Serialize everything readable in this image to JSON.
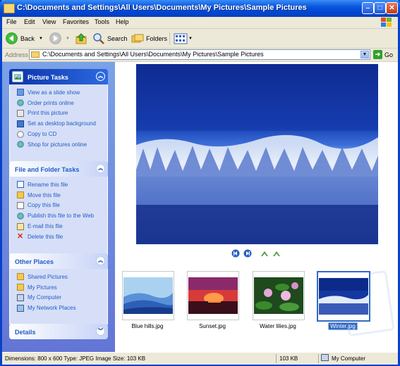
{
  "window": {
    "title": "C:\\Documents and Settings\\All Users\\Documents\\My Pictures\\Sample Pictures",
    "minimize": "–",
    "maximize": "□",
    "close": "✕"
  },
  "menu": [
    "File",
    "Edit",
    "View",
    "Favorites",
    "Tools",
    "Help"
  ],
  "toolbar": {
    "back": "Back",
    "search": "Search",
    "folders": "Folders"
  },
  "address": {
    "label": "Address",
    "value": "C:\\Documents and Settings\\All Users\\Documents\\My Pictures\\Sample Pictures",
    "go": "Go"
  },
  "panels": {
    "picture_tasks": {
      "title": "Picture Tasks",
      "items": [
        "View as a slide show",
        "Order prints online",
        "Print this picture",
        "Set as desktop background",
        "Copy to CD",
        "Shop for pictures online"
      ]
    },
    "file_tasks": {
      "title": "File and Folder Tasks",
      "items": [
        "Rename this file",
        "Move this file",
        "Copy this file",
        "Publish this file to the Web",
        "E-mail this file",
        "Delete this file"
      ]
    },
    "other_places": {
      "title": "Other Places",
      "items": [
        "Shared Pictures",
        "My Pictures",
        "My Computer",
        "My Network Places"
      ]
    },
    "details": {
      "title": "Details"
    }
  },
  "thumbnails": [
    {
      "label": "Blue hills.jpg",
      "selected": false
    },
    {
      "label": "Sunset.jpg",
      "selected": false
    },
    {
      "label": "Water lilies.jpg",
      "selected": false
    },
    {
      "label": "Winter.jpg",
      "selected": true
    }
  ],
  "status": {
    "info": "Dimensions: 800 x 600 Type: JPEG Image Size: 103 KB",
    "size": "103 KB",
    "zone": "My Computer"
  },
  "colors": {
    "titlebar": "#0a56dd",
    "link": "#215dc6",
    "task_pane": "#6375d6",
    "selection": "#316ac5"
  }
}
